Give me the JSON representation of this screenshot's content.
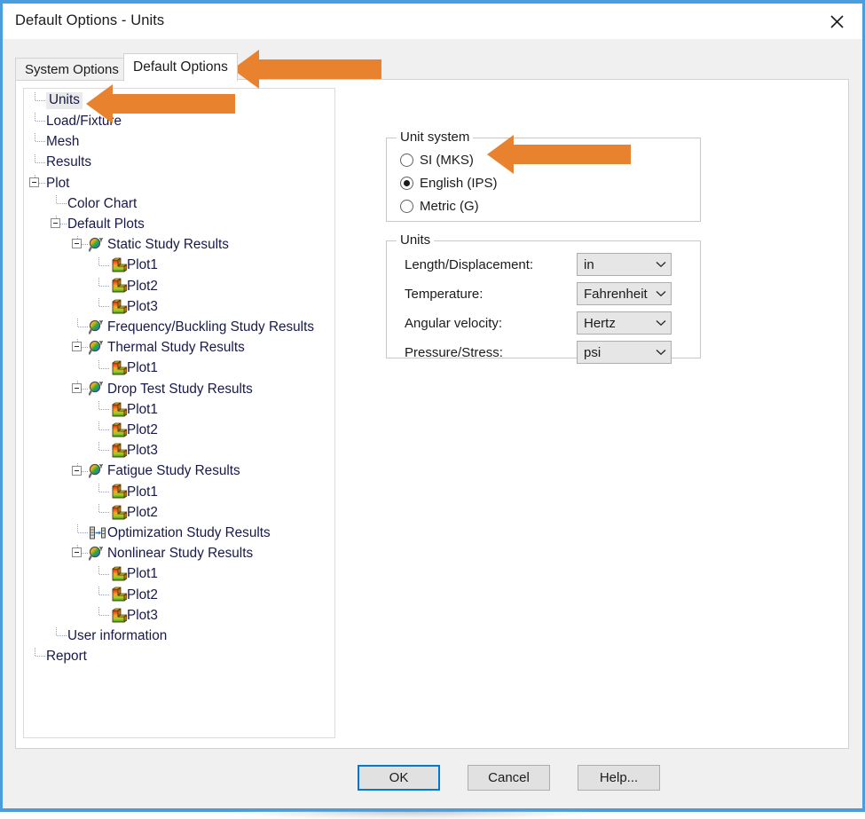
{
  "window": {
    "title": "Default Options - Units",
    "close_icon": "close-icon"
  },
  "tabs": [
    {
      "label": "System Options",
      "active": false
    },
    {
      "label": "Default Options",
      "active": true
    }
  ],
  "tree": {
    "nodes": [
      {
        "label": "Units",
        "depth": 0,
        "icon": "none",
        "expander": "none",
        "selected": true
      },
      {
        "label": "Load/Fixture",
        "depth": 0,
        "icon": "none",
        "expander": "none",
        "selected": false
      },
      {
        "label": "Mesh",
        "depth": 0,
        "icon": "none",
        "expander": "none",
        "selected": false
      },
      {
        "label": "Results",
        "depth": 0,
        "icon": "none",
        "expander": "none",
        "selected": false
      },
      {
        "label": "Plot",
        "depth": 0,
        "icon": "none",
        "expander": "collapse",
        "selected": false
      },
      {
        "label": "Color Chart",
        "depth": 1,
        "icon": "none",
        "expander": "none",
        "selected": false
      },
      {
        "label": "Default Plots",
        "depth": 1,
        "icon": "none",
        "expander": "collapse",
        "selected": false
      },
      {
        "label": "Static Study Results",
        "depth": 2,
        "icon": "study-icon",
        "expander": "collapse",
        "selected": false
      },
      {
        "label": "Plot1",
        "depth": 3,
        "icon": "plot-icon",
        "expander": "none",
        "selected": false
      },
      {
        "label": "Plot2",
        "depth": 3,
        "icon": "plot-icon",
        "expander": "none",
        "selected": false
      },
      {
        "label": "Plot3",
        "depth": 3,
        "icon": "plot-icon",
        "expander": "none",
        "selected": false
      },
      {
        "label": "Frequency/Buckling Study Results",
        "depth": 2,
        "icon": "study-icon",
        "expander": "none",
        "selected": false
      },
      {
        "label": "Thermal Study Results",
        "depth": 2,
        "icon": "study-icon",
        "expander": "collapse",
        "selected": false
      },
      {
        "label": "Plot1",
        "depth": 3,
        "icon": "plot-icon",
        "expander": "none",
        "selected": false
      },
      {
        "label": "Drop Test Study Results",
        "depth": 2,
        "icon": "study-icon",
        "expander": "collapse",
        "selected": false
      },
      {
        "label": "Plot1",
        "depth": 3,
        "icon": "plot-icon",
        "expander": "none",
        "selected": false
      },
      {
        "label": "Plot2",
        "depth": 3,
        "icon": "plot-icon",
        "expander": "none",
        "selected": false
      },
      {
        "label": "Plot3",
        "depth": 3,
        "icon": "plot-icon",
        "expander": "none",
        "selected": false
      },
      {
        "label": "Fatigue Study Results",
        "depth": 2,
        "icon": "study-icon",
        "expander": "collapse",
        "selected": false
      },
      {
        "label": "Plot1",
        "depth": 3,
        "icon": "plot-icon",
        "expander": "none",
        "selected": false
      },
      {
        "label": "Plot2",
        "depth": 3,
        "icon": "plot-icon",
        "expander": "none",
        "selected": false
      },
      {
        "label": "Optimization Study Results",
        "depth": 2,
        "icon": "optimization-icon",
        "expander": "none",
        "selected": false
      },
      {
        "label": "Nonlinear Study Results",
        "depth": 2,
        "icon": "study-icon",
        "expander": "collapse",
        "selected": false
      },
      {
        "label": "Plot1",
        "depth": 3,
        "icon": "plot-icon",
        "expander": "none",
        "selected": false
      },
      {
        "label": "Plot2",
        "depth": 3,
        "icon": "plot-icon",
        "expander": "none",
        "selected": false
      },
      {
        "label": "Plot3",
        "depth": 3,
        "icon": "plot-icon",
        "expander": "none",
        "selected": false
      },
      {
        "label": "User information",
        "depth": 1,
        "icon": "none",
        "expander": "none",
        "selected": false
      },
      {
        "label": "Report",
        "depth": 0,
        "icon": "none",
        "expander": "none",
        "selected": false
      }
    ]
  },
  "unit_system": {
    "group_title": "Unit system",
    "options": [
      {
        "label": "SI (MKS)",
        "selected": false
      },
      {
        "label": "English (IPS)",
        "selected": true
      },
      {
        "label": "Metric (G)",
        "selected": false
      }
    ]
  },
  "units": {
    "group_title": "Units",
    "fields": [
      {
        "label": "Length/Displacement:",
        "value": "in"
      },
      {
        "label": "Temperature:",
        "value": "Fahrenheit"
      },
      {
        "label": "Angular velocity:",
        "value": "Hertz"
      },
      {
        "label": "Pressure/Stress:",
        "value": "psi"
      }
    ]
  },
  "buttons": {
    "ok": "OK",
    "cancel": "Cancel",
    "help": "Help..."
  },
  "annotations": {
    "arrow_color": "#e8822f",
    "arrows": [
      {
        "name": "arrow-to-default-options-tab",
        "points_to": "Default Options"
      },
      {
        "name": "arrow-to-units-tree-node",
        "points_to": "Units"
      },
      {
        "name": "arrow-to-english-ips-radio",
        "points_to": "English (IPS)"
      }
    ]
  },
  "colors": {
    "window_border": "#4a9ede",
    "accent": "#0078d7",
    "tree_text": "#16194a",
    "dialog_bg": "#f0f0f0"
  }
}
